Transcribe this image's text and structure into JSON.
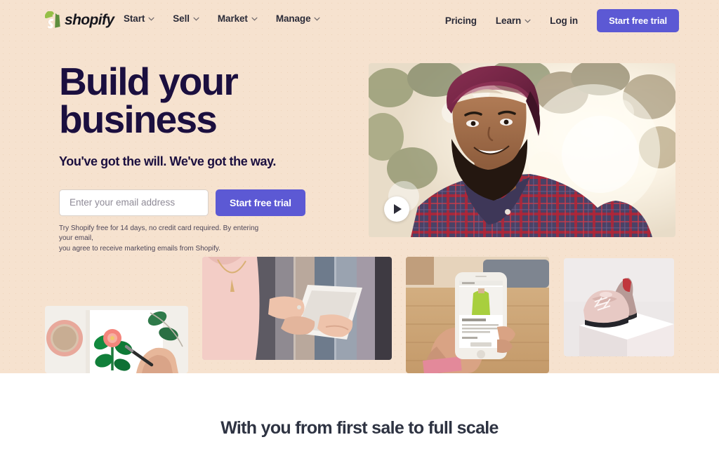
{
  "brand": {
    "name": "shopify",
    "logo_icon": "shopify-bag-icon",
    "logo_color": "#95bf47",
    "wordmark_color": "#16161d"
  },
  "colors": {
    "background_peach": "#f6e2cf",
    "accent_purple": "#5c59d4",
    "heading_navy": "#1b0f3f",
    "bottom_heading": "#2e3342"
  },
  "header": {
    "nav_left": [
      {
        "label": "Start",
        "icon": "chevron-down-icon"
      },
      {
        "label": "Sell",
        "icon": "chevron-down-icon"
      },
      {
        "label": "Market",
        "icon": "chevron-down-icon"
      },
      {
        "label": "Manage",
        "icon": "chevron-down-icon"
      }
    ],
    "nav_right": [
      {
        "label": "Pricing",
        "icon": null
      },
      {
        "label": "Learn",
        "icon": "chevron-down-icon"
      },
      {
        "label": "Log in",
        "icon": null
      }
    ],
    "cta_label": "Start free trial"
  },
  "hero": {
    "title_line1": "Build your",
    "title_line2": "business",
    "subtitle": "You've got the will. We've got the way.",
    "email_placeholder": "Enter your email address",
    "email_value": "",
    "cta_label": "Start free trial",
    "disclaimer_line1": "Try Shopify free for 14 days, no credit card required. By entering your email,",
    "disclaimer_line2": "you agree to receive marketing emails from Shopify.",
    "video": {
      "name": "hero-video-thumbnail",
      "description": "Smiling man wearing a maroon turban and red plaid shirt outdoors, backlit by sun through trees",
      "play_icon": "play-icon"
    }
  },
  "gallery": [
    {
      "name": "image-sketching-flower",
      "description": "Overhead view of a hand sketching a pink flower in a notebook beside a pink coffee cup and eucalyptus leaves"
    },
    {
      "name": "image-tablet-clothing-rack",
      "description": "Person in a pink blouse using a white tablet in front of a rack of hanging garments"
    },
    {
      "name": "image-phone-online-store",
      "description": "Hand holding a white iPhone displaying an online store product page on a wooden floor"
    },
    {
      "name": "image-pink-shoes-pedestal",
      "description": "Pair of pale pink leather brogues displayed on a white pedestal"
    }
  ],
  "bottom": {
    "heading": "With you from first sale to full scale"
  }
}
